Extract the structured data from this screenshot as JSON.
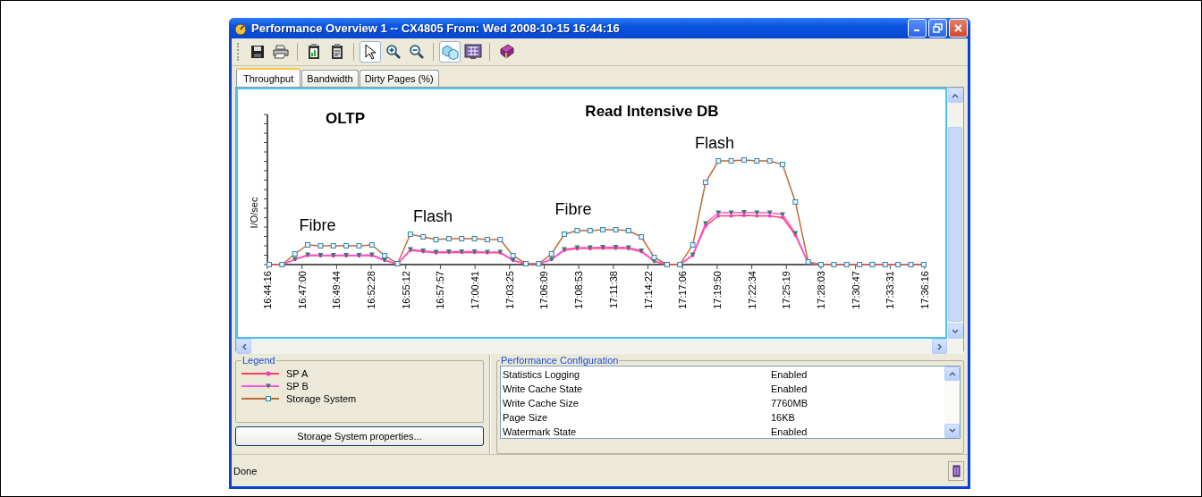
{
  "window": {
    "title": "Performance Overview 1 -- CX4805 From: Wed 2008-10-15 16:44:16"
  },
  "toolbar_groups": [
    {
      "buttons": [
        {
          "kind": "save",
          "pressed": false
        },
        {
          "kind": "print",
          "pressed": false
        }
      ]
    },
    {
      "buttons": [
        {
          "kind": "chart-clip",
          "pressed": false
        },
        {
          "kind": "doc-clip",
          "pressed": false
        }
      ]
    },
    {
      "buttons": [
        {
          "kind": "pointer",
          "pressed": true
        },
        {
          "kind": "zoom-in",
          "pressed": false
        },
        {
          "kind": "zoom-out",
          "pressed": false
        }
      ]
    },
    {
      "buttons": [
        {
          "kind": "cubes",
          "pressed": true
        },
        {
          "kind": "screen",
          "pressed": false
        }
      ]
    },
    {
      "buttons": [
        {
          "kind": "book",
          "pressed": false
        }
      ]
    }
  ],
  "tabs": [
    {
      "label": "Throughput",
      "selected": true
    },
    {
      "label": "Bandwidth",
      "selected": false
    },
    {
      "label": "Dirty Pages (%)",
      "selected": false
    }
  ],
  "chart": {
    "ylabel": "I/O/sec",
    "annotations": [
      {
        "text": "OLTP",
        "kind": "heading"
      },
      {
        "text": "Read Intensive DB",
        "kind": "heading"
      },
      {
        "text": "Fibre",
        "kind": "note"
      },
      {
        "text": "Flash",
        "kind": "note"
      },
      {
        "text": "Fibre",
        "kind": "note"
      },
      {
        "text": "Flash",
        "kind": "note"
      }
    ],
    "xlabels": [
      "16:44:16",
      "16:47:00",
      "16:49:44",
      "16:52:28",
      "16:55:12",
      "16:57:57",
      "17:00:41",
      "17:03:25",
      "17:06:09",
      "17:08:53",
      "17:11:38",
      "17:14:22",
      "17:17:06",
      "17:19:50",
      "17:22:34",
      "17:25:19",
      "17:28:03",
      "17:30:47",
      "17:33:31",
      "17:36:16"
    ]
  },
  "legend": {
    "title": "Legend",
    "items": [
      {
        "label": "SP A",
        "color": "#ff4060",
        "kind": "dot"
      },
      {
        "label": "SP B",
        "color": "#ff55dd",
        "kind": "triangle"
      },
      {
        "label": "Storage System",
        "color": "#c06a3a",
        "kind": "square"
      }
    ]
  },
  "properties_button": "Storage System properties...",
  "configuration": {
    "title": "Performance Configuration",
    "rows": [
      {
        "name": "Statistics Logging",
        "value": "Enabled"
      },
      {
        "name": "Write Cache State",
        "value": "Enabled"
      },
      {
        "name": "Write Cache Size",
        "value": "7760MB"
      },
      {
        "name": "Page Size",
        "value": "16KB"
      },
      {
        "name": "Watermark State",
        "value": "Enabled"
      }
    ]
  },
  "status": "Done"
}
